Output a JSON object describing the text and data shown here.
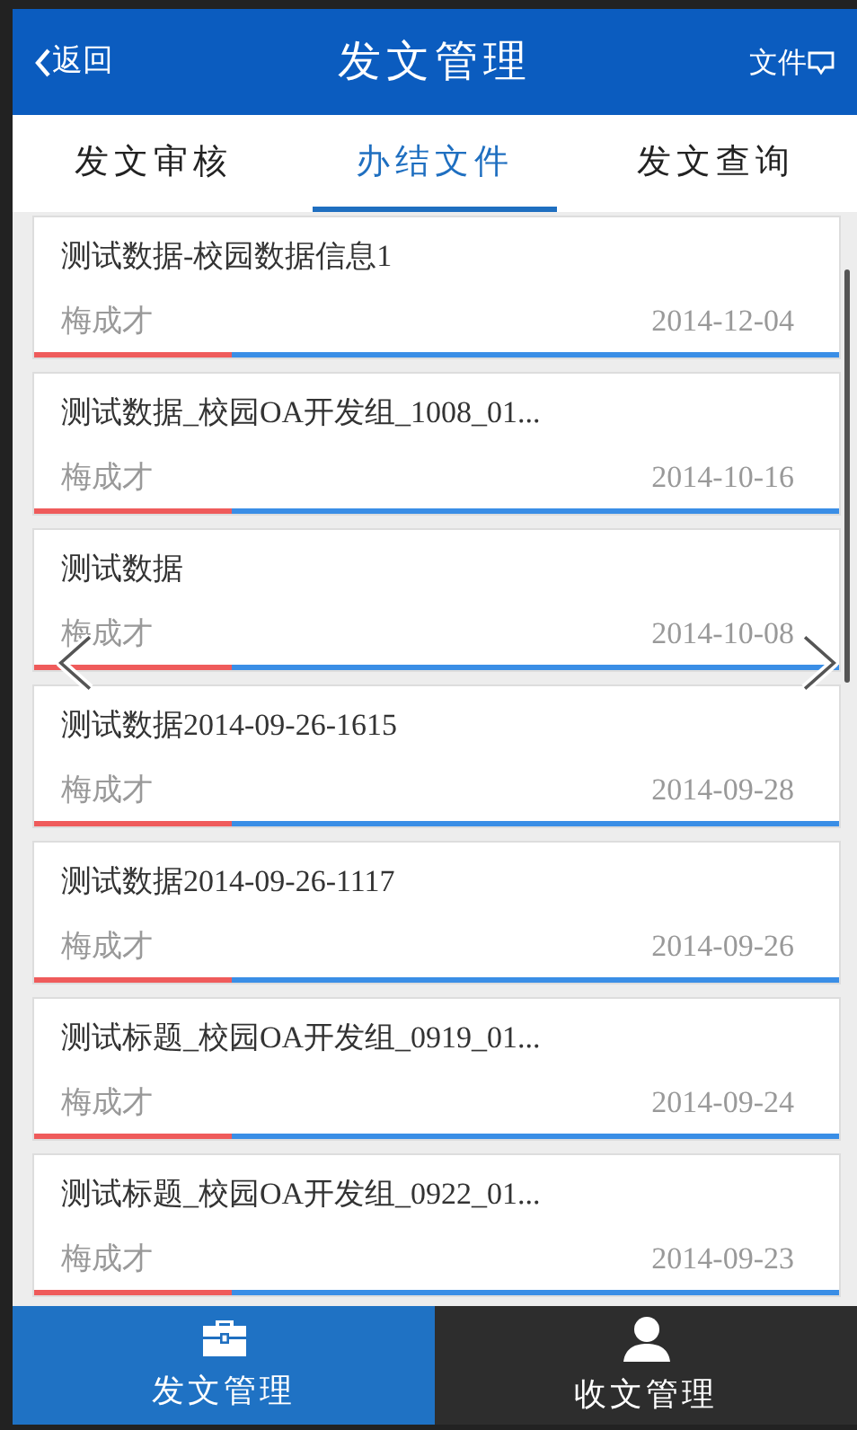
{
  "header": {
    "back": "返回",
    "title": "发文管理",
    "action": "文件"
  },
  "tabs": [
    {
      "label": "发文审核",
      "selected": false
    },
    {
      "label": "办结文件",
      "selected": true
    },
    {
      "label": "发文查询",
      "selected": false
    }
  ],
  "documents": [
    {
      "title": "测试数据-校园数据信息1",
      "author": "梅成才",
      "date": "2014-12-04"
    },
    {
      "title": "测试数据_校园OA开发组_1008_01...",
      "author": "梅成才",
      "date": "2014-10-16"
    },
    {
      "title": "测试数据",
      "author": "梅成才",
      "date": "2014-10-08"
    },
    {
      "title": "测试数据2014-09-26-1615",
      "author": "梅成才",
      "date": "2014-09-28"
    },
    {
      "title": "测试数据2014-09-26-1117",
      "author": "梅成才",
      "date": "2014-09-26"
    },
    {
      "title": "测试标题_校园OA开发组_0919_01...",
      "author": "梅成才",
      "date": "2014-09-24"
    },
    {
      "title": "测试标题_校园OA开发组_0922_01...",
      "author": "梅成才",
      "date": "2014-09-23"
    }
  ],
  "bottom_nav": [
    {
      "label": "发文管理",
      "kind": "briefcase",
      "selected": true
    },
    {
      "label": "收文管理",
      "kind": "person",
      "selected": false
    }
  ]
}
